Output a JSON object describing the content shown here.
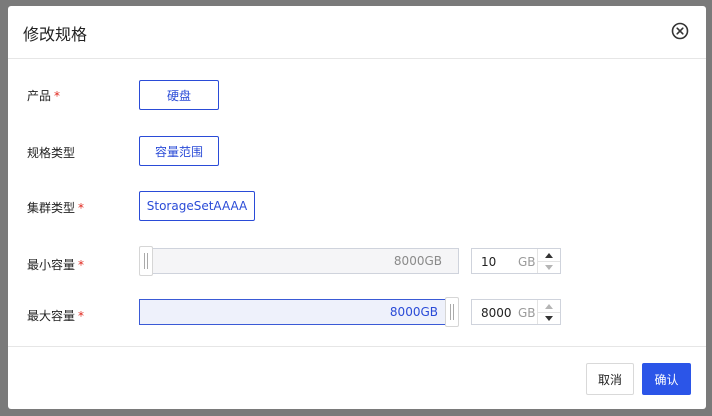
{
  "dialog": {
    "title": "修改规格"
  },
  "form": {
    "product": {
      "label": "产品",
      "required": "*",
      "value": "硬盘"
    },
    "spec_type": {
      "label": "规格类型",
      "value": "容量范围"
    },
    "cluster_type": {
      "label": "集群类型",
      "required": "*",
      "value": "StorageSetAAAA"
    },
    "min_capacity": {
      "label": "最小容量",
      "required": "*",
      "slider_text": "8000GB",
      "input_value": "10",
      "unit": "GB",
      "fraction": 0.0
    },
    "max_capacity": {
      "label": "最大容量",
      "required": "*",
      "slider_text": "8000GB",
      "input_value": "8000",
      "unit": "GB",
      "fraction": 1.0
    }
  },
  "footer": {
    "cancel_label": "取消",
    "ok_label": "确认"
  },
  "colors": {
    "accent": "#2b55e8",
    "required": "#e0281e"
  },
  "icons": {
    "close": "close-circle-icon",
    "stepper_up": "caret-up-icon",
    "stepper_down": "caret-down-icon"
  }
}
